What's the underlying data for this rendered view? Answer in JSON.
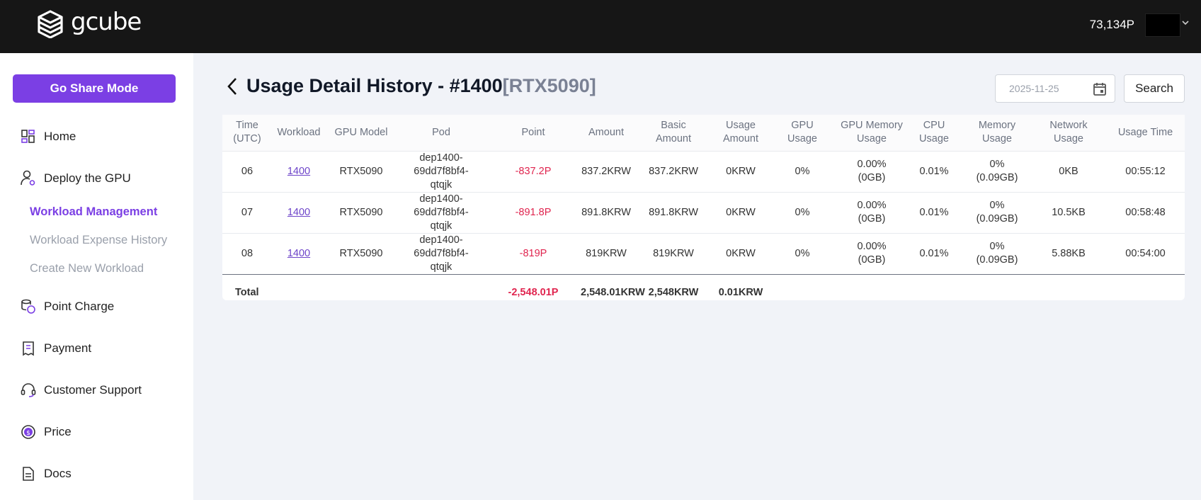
{
  "header": {
    "logo_text": "gcube",
    "balance": "73,134P"
  },
  "sidebar": {
    "share_button": "Go Share Mode",
    "items": [
      {
        "label": "Home",
        "icon": "home-icon"
      },
      {
        "label": "Deploy the GPU",
        "icon": "user-gear-icon"
      },
      {
        "label": "Point Charge",
        "icon": "coin-stack-icon"
      },
      {
        "label": "Payment",
        "icon": "receipt-icon"
      },
      {
        "label": "Customer Support",
        "icon": "headset-icon"
      },
      {
        "label": "Price",
        "icon": "dollar-circle-icon"
      },
      {
        "label": "Docs",
        "icon": "document-icon"
      }
    ],
    "subitems": [
      {
        "label": "Workload Management",
        "active": true
      },
      {
        "label": "Workload Expense History",
        "active": false
      },
      {
        "label": "Create New Workload",
        "active": false
      }
    ]
  },
  "page": {
    "title": "Usage Detail History - #1400",
    "gpu_tag": "[RTX5090]",
    "date_value": "2025-11-25",
    "search_label": "Search"
  },
  "table": {
    "headers": [
      [
        "Time",
        "(UTC)"
      ],
      [
        "Workload"
      ],
      [
        "GPU Model"
      ],
      [
        "Pod"
      ],
      [
        "Point"
      ],
      [
        "Amount"
      ],
      [
        "Basic",
        "Amount"
      ],
      [
        "Usage",
        "Amount"
      ],
      [
        "GPU",
        "Usage"
      ],
      [
        "GPU Memory",
        "Usage"
      ],
      [
        "CPU",
        "Usage"
      ],
      [
        "Memory",
        "Usage"
      ],
      [
        "Network",
        "Usage"
      ],
      [
        "Usage Time"
      ]
    ],
    "rows": [
      {
        "time": "06",
        "workload": "1400",
        "gpu_model": "RTX5090",
        "pod": [
          "dep1400-69dd7f8bf4-",
          "qtqjk"
        ],
        "point": "-837.2P",
        "amount": "837.2KRW",
        "basic_amount": "837.2KRW",
        "usage_amount": "0KRW",
        "gpu_usage": "0%",
        "gpu_mem": [
          "0.00%",
          "(0GB)"
        ],
        "cpu_usage": "0.01%",
        "mem_usage": [
          "0%",
          "(0.09GB)"
        ],
        "net_usage": "0KB",
        "usage_time": "00:55:12"
      },
      {
        "time": "07",
        "workload": "1400",
        "gpu_model": "RTX5090",
        "pod": [
          "dep1400-69dd7f8bf4-",
          "qtqjk"
        ],
        "point": "-891.8P",
        "amount": "891.8KRW",
        "basic_amount": "891.8KRW",
        "usage_amount": "0KRW",
        "gpu_usage": "0%",
        "gpu_mem": [
          "0.00%",
          "(0GB)"
        ],
        "cpu_usage": "0.01%",
        "mem_usage": [
          "0%",
          "(0.09GB)"
        ],
        "net_usage": "10.5KB",
        "usage_time": "00:58:48"
      },
      {
        "time": "08",
        "workload": "1400",
        "gpu_model": "RTX5090",
        "pod": [
          "dep1400-69dd7f8bf4-",
          "qtqjk"
        ],
        "point": "-819P",
        "amount": "819KRW",
        "basic_amount": "819KRW",
        "usage_amount": "0KRW",
        "gpu_usage": "0%",
        "gpu_mem": [
          "0.00%",
          "(0GB)"
        ],
        "cpu_usage": "0.01%",
        "mem_usage": [
          "0%",
          "(0.09GB)"
        ],
        "net_usage": "5.88KB",
        "usage_time": "00:54:00"
      }
    ],
    "total": {
      "label": "Total",
      "point": "-2,548.01P",
      "amount": "2,548.01KRW",
      "basic_amount": "2,548KRW",
      "usage_amount": "0.01KRW"
    }
  },
  "colors": {
    "accent": "#7b3fe4",
    "negative": "#e0254f",
    "topbar": "#161616"
  }
}
